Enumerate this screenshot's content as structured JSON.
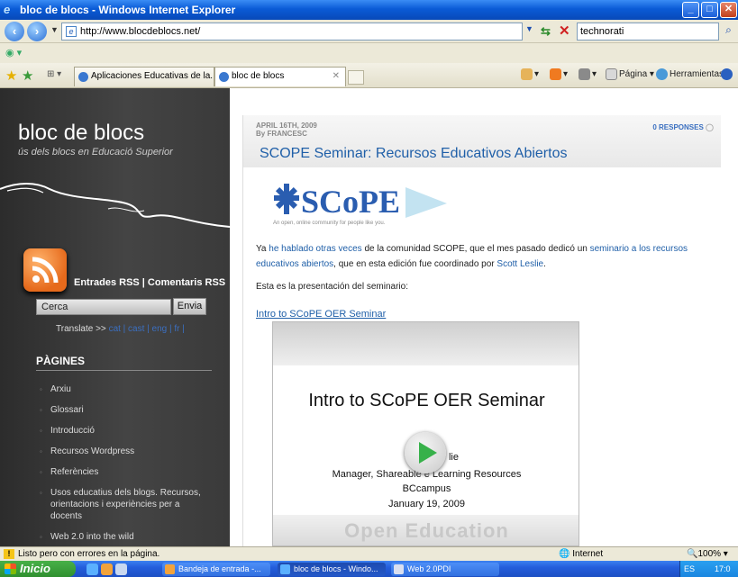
{
  "window": {
    "title": "bloc de blocs - Windows Internet Explorer",
    "minimize": "_",
    "maximize": "□",
    "close": "✕"
  },
  "address_bar": {
    "url": "http://www.blocdeblocs.net/",
    "search_value": "technorati"
  },
  "tabs": [
    {
      "label": "Aplicaciones Educativas de la..."
    },
    {
      "label": "bloc de blocs"
    }
  ],
  "toolbar": {
    "page_label": "Página",
    "tools_label": "Herramientas"
  },
  "sidebar": {
    "blog_title": "bloc de blocs",
    "blog_subtitle": "ús dels blocs en Educació Superior",
    "rss_links": "Entrades RSS | Comentaris RSS",
    "search_value": "Cerca",
    "search_button": "Envia",
    "translate_label": "Translate >>",
    "translate_langs": "cat | cast | eng | fr |",
    "pages_heading": "PÀGINES",
    "pages": [
      "Arxiu",
      "Glossari",
      "Introducció",
      "Recursos Wordpress",
      "Referències",
      "Usos educatius dels blogs. Recursos, orientacions i experiències per a docents",
      "Web 2.0 into the wild"
    ]
  },
  "post": {
    "date": "APRIL 16TH, 2009",
    "author": "By FRANCESC",
    "responses": "0 RESPONSES",
    "title": "SCOPE Seminar: Recursos Educativos Abiertos",
    "logo_text": "SCoPE",
    "logo_tagline": "An open, online community for people like you.",
    "para1_a": "Ya ",
    "para1_link1": "he hablado otras veces",
    "para1_b": " de la comunidad SCOPE, que el mes pasado dedicó un ",
    "para1_link2": "seminario a los recursos educativos abiertos",
    "para1_c": ",  que en esta edición fue coordinado por ",
    "para1_link3": "Scott Leslie",
    "para1_d": ".",
    "para2": "Esta es la presentación del seminario:",
    "video_link": "Intro to SCoPE OER Seminar",
    "video_title": "Intro to SCoPE OER Seminar",
    "video_line1": "lie",
    "video_line2": "Manager, Shareable      e Learning Resources",
    "video_line3": "BCcampus",
    "video_line4": "January 19, 2009",
    "video_bottom": "Open Education"
  },
  "statusbar": {
    "text": "Listo pero con errores en la página.",
    "zone": "Internet",
    "zoom": "100%"
  },
  "taskbar": {
    "start_label": "Inicio",
    "items": [
      "Bandeja de entrada -...",
      "bloc de blocs - Windo...",
      "Web 2.0PDI"
    ],
    "tray_lang": "ES",
    "clock": "17:0"
  },
  "colors": {
    "link": "#1f5fa8",
    "sidebar_bg": "#3a3a3a",
    "xp_blue": "#245edc"
  }
}
